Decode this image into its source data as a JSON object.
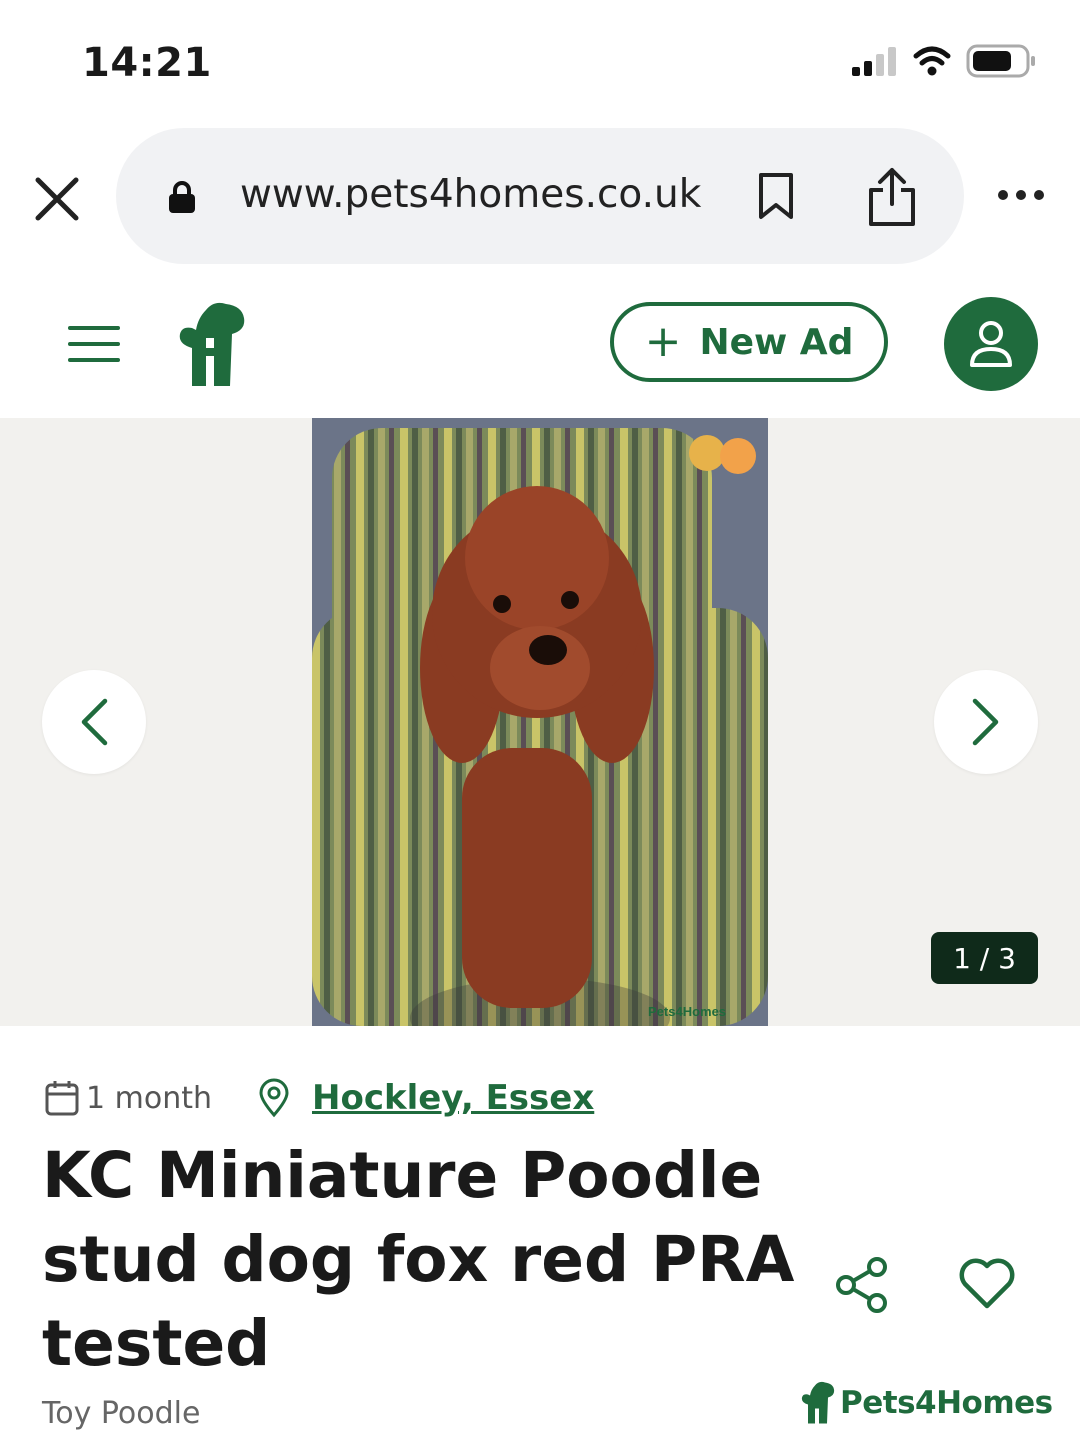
{
  "status_bar": {
    "time": "14:21"
  },
  "browser": {
    "url": "www.pets4homes.co.uk"
  },
  "header": {
    "new_ad_plus": "+",
    "new_ad_label": "New Ad"
  },
  "gallery": {
    "counter": "1 / 3",
    "watermark": "Pets4Homes"
  },
  "listing": {
    "age": "1 month",
    "location": "Hockley, Essex",
    "title": "KC Miniature Poodle stud dog fox red PRA tested",
    "breed": "Toy Poodle"
  },
  "footer": {
    "brand": "Pets4Homes"
  },
  "colors": {
    "brand_green": "#1f6b3d",
    "counter_bg": "#0f2a1a",
    "gallery_bg": "#f2f1ee"
  }
}
